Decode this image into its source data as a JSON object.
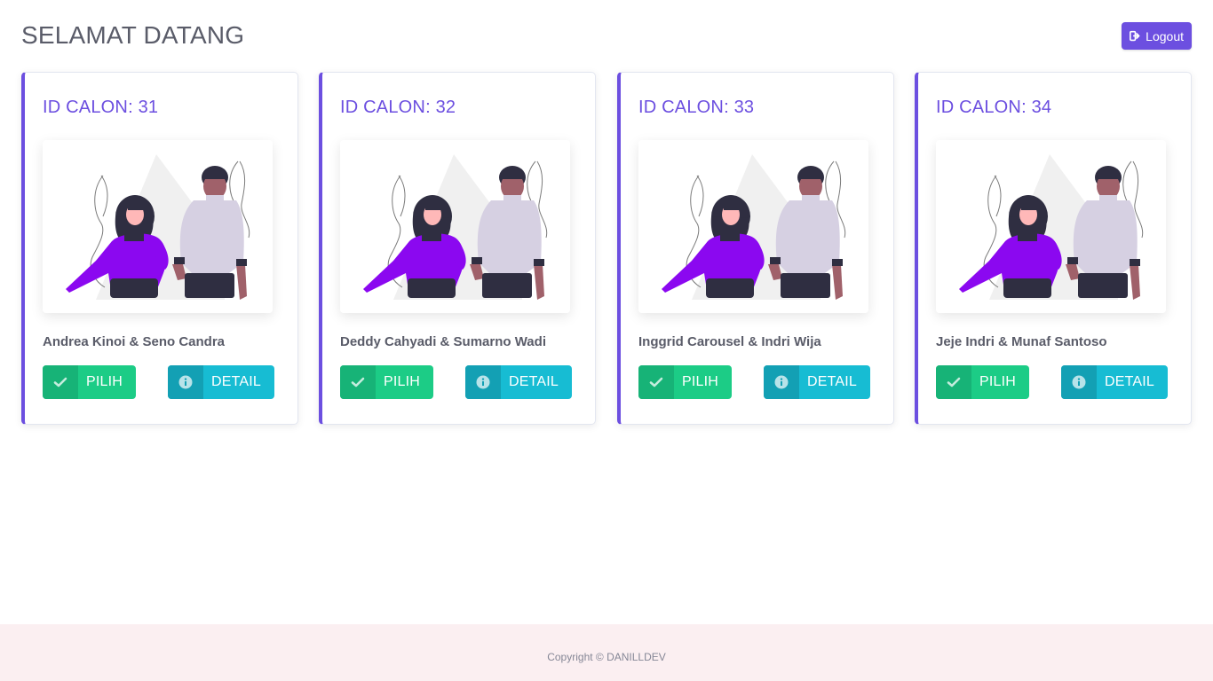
{
  "header": {
    "title": "SELAMAT DATANG",
    "logout_label": "Logout"
  },
  "accent_color": "#6c4fe0",
  "cards": [
    {
      "title": "ID CALON: 31",
      "names": "Andrea Kinoi & Seno Candra",
      "pilih_label": "PILIH",
      "detail_label": "DETAIL"
    },
    {
      "title": "ID CALON: 32",
      "names": "Deddy Cahyadi & Sumarno Wadi",
      "pilih_label": "PILIH",
      "detail_label": "DETAIL"
    },
    {
      "title": "ID CALON: 33",
      "names": "Inggrid Carousel & Indri Wija",
      "pilih_label": "PILIH",
      "detail_label": "DETAIL"
    },
    {
      "title": "ID CALON: 34",
      "names": "Jeje Indri & Munaf Santoso",
      "pilih_label": "PILIH",
      "detail_label": "DETAIL"
    }
  ],
  "footer": {
    "copyright": "Copyright © DANILLDEV"
  }
}
